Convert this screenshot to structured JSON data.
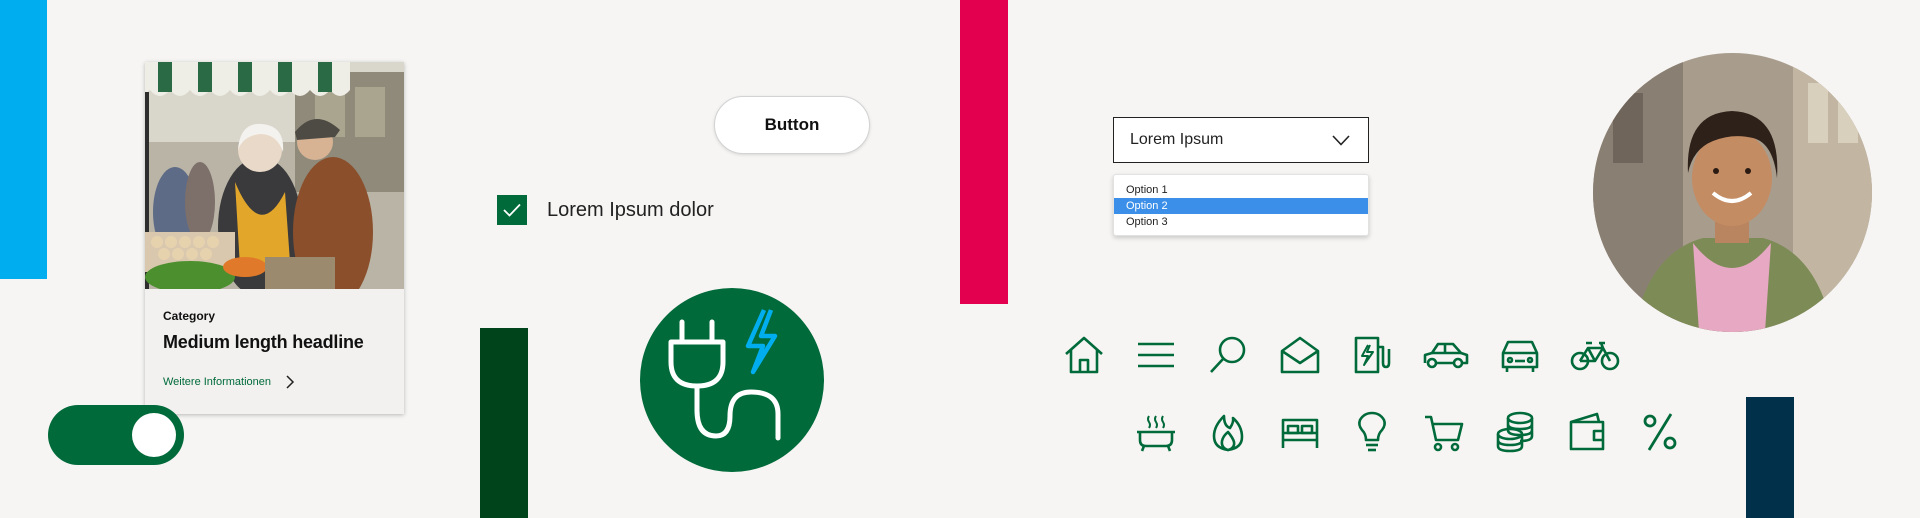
{
  "colors": {
    "brand_green": "#006a3a",
    "dark_green": "#00441b",
    "accent_blue": "#00aeef",
    "accent_red": "#e3004f",
    "navy": "#00304a",
    "selection_blue": "#3b8fe8",
    "background": "#f6f5f3"
  },
  "card": {
    "image": "market-photo",
    "category": "Category",
    "headline": "Medium length headline",
    "link_label": "Weitere Informationen",
    "link_icon": "chevron-right-icon"
  },
  "toggle": {
    "state": "on"
  },
  "button": {
    "label": "Button"
  },
  "checkbox": {
    "label": "Lorem Ipsum dolor",
    "checked": true,
    "icon": "checkmark-icon"
  },
  "plug_badge": {
    "icon": "ev-plug-icon"
  },
  "dropdown": {
    "selected_value": "Lorem Ipsum",
    "icon": "chevron-down-icon",
    "options": [
      "Option 1",
      "Option 2",
      "Option 3"
    ],
    "highlighted_option": "Option 2"
  },
  "portrait": {
    "image": "woman-portrait-photo"
  },
  "icons": {
    "row1": [
      "home-icon",
      "menu-icon",
      "search-icon",
      "mail-icon",
      "charging-station-icon",
      "car-icon",
      "car-front-icon",
      "bicycle-icon"
    ],
    "row2": [
      "bathtub-icon",
      "flame-icon",
      "bed-icon",
      "lightbulb-icon",
      "cart-icon",
      "coins-icon",
      "wallet-icon",
      "percent-icon"
    ]
  }
}
